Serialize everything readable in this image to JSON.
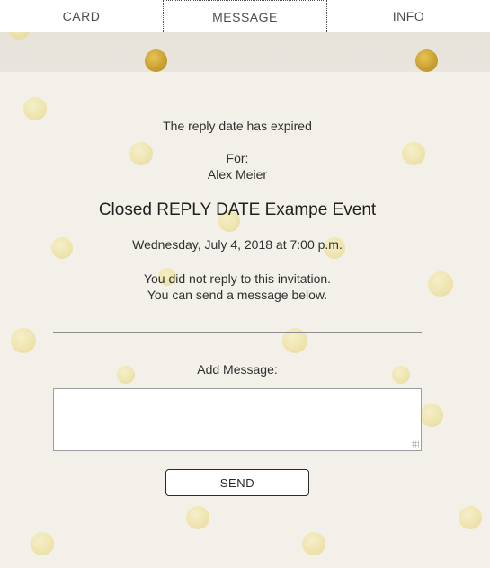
{
  "tabs": [
    {
      "label": "CARD",
      "active": false
    },
    {
      "label": "MESSAGE",
      "active": true
    },
    {
      "label": "INFO",
      "active": false
    }
  ],
  "main": {
    "status": "The reply date has expired",
    "for_label": "For:",
    "recipient": "Alex Meier",
    "event_title": "Closed REPLY DATE Exampe Event",
    "event_datetime": "Wednesday, July 4, 2018 at 7:00 p.m.",
    "notice_line1": "You did not reply to this invitation.",
    "notice_line2": "You can send a message below.",
    "add_message_label": "Add Message:",
    "message_value": "",
    "send_label": "SEND"
  },
  "colors": {
    "dot_pale": "#efe2a0",
    "dot_gold": "#c59a25",
    "paper": "#f3f0ea"
  }
}
